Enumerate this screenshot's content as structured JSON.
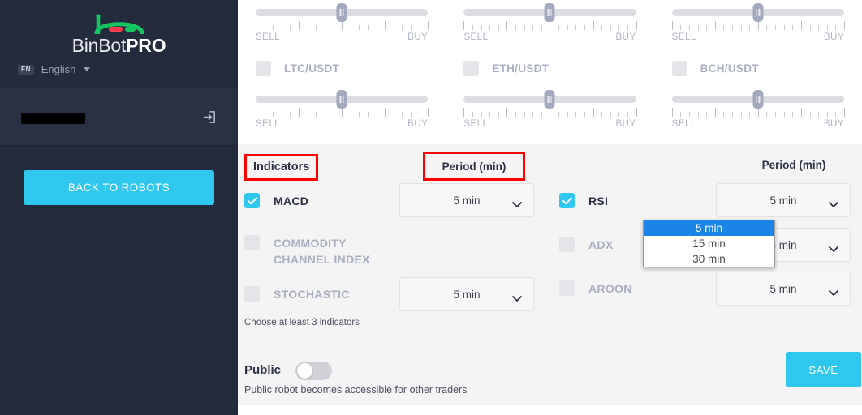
{
  "sidebar": {
    "logo": {
      "name_thin": "BinBot",
      "name_bold": "PRO",
      "icon": "binbot-arc-logo"
    },
    "language": {
      "badge": "EN",
      "name": "English",
      "caret_icon": "caret-down-icon"
    },
    "user": {
      "redacted": "",
      "logout_icon": "logout-icon"
    },
    "back_button": "BACK TO ROBOTS",
    "colors": {
      "bg": "#242b3d",
      "user_bg": "#2a3145",
      "accent": "#30c7ee"
    }
  },
  "pairs": {
    "slider_labels": {
      "sell": "SELL",
      "buy": "BUY"
    },
    "columns": [
      {
        "name": "LTC/USDT",
        "checked": false
      },
      {
        "name": "ETH/USDT",
        "checked": false
      },
      {
        "name": "BCH/USDT",
        "checked": false
      }
    ]
  },
  "indicators": {
    "header_left": "Indicators",
    "header_period_left": "Period (min)",
    "header_period_right": "Period (min)",
    "hint": "Choose at least 3 indicators",
    "left_column": [
      {
        "label": "MACD",
        "checked": true,
        "period": "5 min"
      },
      {
        "label": "COMMODITY CHANNEL INDEX",
        "checked": false,
        "period": ""
      },
      {
        "label": "STOCHASTIC",
        "checked": false,
        "period": "5 min"
      }
    ],
    "right_column": [
      {
        "label": "RSI",
        "checked": true,
        "period": "5 min"
      },
      {
        "label": "ADX",
        "checked": false,
        "period": "5 min"
      },
      {
        "label": "AROON",
        "checked": false,
        "period": "5 min"
      }
    ],
    "open_dropdown": {
      "for": "MACD",
      "options": [
        "5 min",
        "15 min",
        "30 min"
      ],
      "selected": "5 min",
      "highlight_color": "#1b84e7"
    },
    "annotation_color": "#fb0000"
  },
  "footer": {
    "public_label": "Public",
    "public_toggle_on": false,
    "public_description": "Public robot becomes accessible for other traders",
    "save_label": "SAVE"
  }
}
